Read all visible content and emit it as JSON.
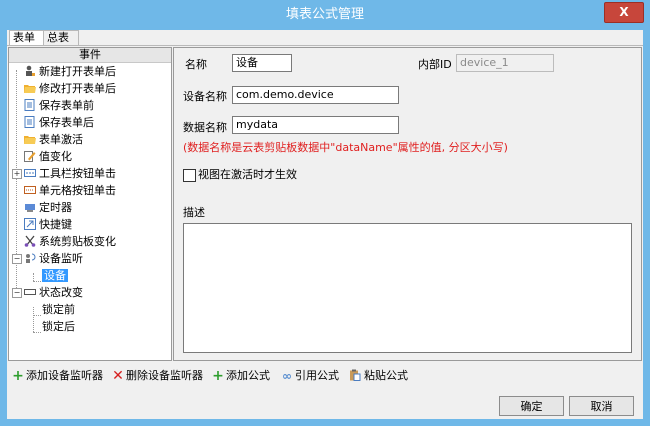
{
  "window": {
    "title": "填表公式管理",
    "close_label": "X"
  },
  "tabs": [
    {
      "label": "表单"
    },
    {
      "label": "总表"
    }
  ],
  "tree": {
    "header": "事件",
    "items": [
      {
        "label": "新建打开表单后"
      },
      {
        "label": "修改打开表单后"
      },
      {
        "label": "保存表单前"
      },
      {
        "label": "保存表单后"
      },
      {
        "label": "表单激活"
      },
      {
        "label": "值变化"
      },
      {
        "label": "工具栏按钮单击"
      },
      {
        "label": "单元格按钮单击"
      },
      {
        "label": "定时器"
      },
      {
        "label": "快捷键"
      },
      {
        "label": "系统剪贴板变化"
      },
      {
        "label": "设备监听"
      },
      {
        "label": "设备"
      },
      {
        "label": "状态改变"
      },
      {
        "label": "锁定前"
      },
      {
        "label": "锁定后"
      }
    ]
  },
  "form": {
    "name_label": "名称",
    "name_value": "设备",
    "internal_id_label": "内部ID",
    "internal_id_value": "device_1",
    "device_name_label": "设备名称",
    "device_name_value": "com.demo.device",
    "data_name_label": "数据名称",
    "data_name_value": "mydata",
    "note": "(数据名称是云表剪贴板数据中\"dataName\"属性的值, 分区大小写)",
    "checkbox_label": "视图在激活时才生效",
    "checkbox_checked": false,
    "description_label": "描述",
    "description_value": ""
  },
  "toolbar": {
    "add_listener": "添加设备监听器",
    "delete_listener": "删除设备监听器",
    "add_formula": "添加公式",
    "ref_formula": "引用公式",
    "paste_formula": "粘贴公式"
  },
  "buttons": {
    "ok": "确定",
    "cancel": "取消"
  },
  "colors": {
    "titlebar": "#6fb8e8",
    "close": "#c7463b",
    "selection": "#3399ff",
    "note": "#e02020",
    "add": "#2e9e2e",
    "delete": "#d62020"
  }
}
